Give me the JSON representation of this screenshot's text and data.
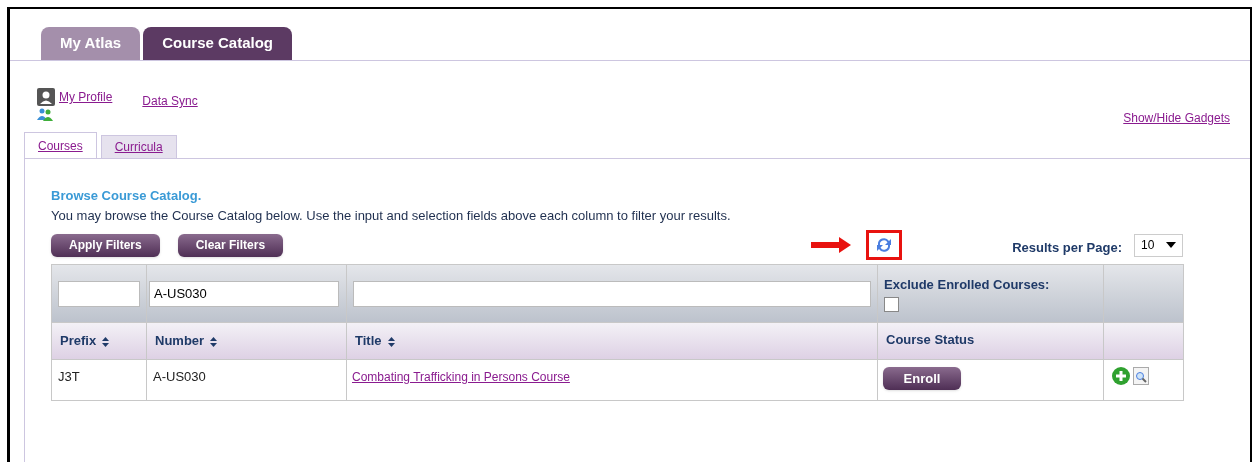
{
  "main_tabs": [
    {
      "label": "My Atlas",
      "selected": false
    },
    {
      "label": "Course Catalog",
      "selected": true
    }
  ],
  "links": {
    "profile": "My Profile",
    "data_sync": "Data Sync",
    "gadgets": "Show/Hide Gadgets"
  },
  "sub_tabs": [
    {
      "label": "Courses",
      "selected": true
    },
    {
      "label": "Curricula",
      "selected": false
    }
  ],
  "heading": "Browse Course Catalog.",
  "description": "You may browse the Course Catalog below. Use the input and selection fields above each column to filter your results.",
  "buttons": [
    "Apply Filters",
    "Clear Filters"
  ],
  "results_per_page": {
    "label": "Results per Page:",
    "value": "10"
  },
  "filters": {
    "number": "A-US030",
    "exclude_label": "Exclude Enrolled Courses:",
    "exclude_checked": false
  },
  "columns": [
    {
      "label": "Prefix",
      "sortable": true
    },
    {
      "label": "Number",
      "sortable": true
    },
    {
      "label": "Title",
      "sortable": true
    },
    {
      "label": "Course Status",
      "sortable": false
    }
  ],
  "rows": [
    {
      "prefix": "J3T",
      "number": "A-US030",
      "title": "Combating Trafficking in Persons Course",
      "action": "Enroll"
    }
  ]
}
